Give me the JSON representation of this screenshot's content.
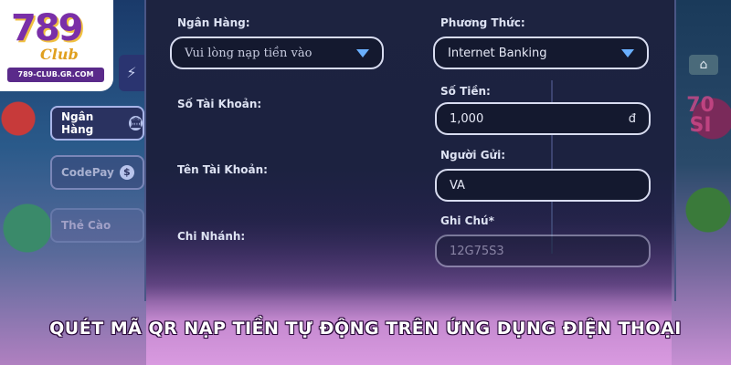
{
  "logo": {
    "number": "789",
    "club": "Club",
    "url": "789-CLUB.GR.COM"
  },
  "sidebar": {
    "top_icon": "⚡",
    "tabs": [
      {
        "label": "Ngân Hàng",
        "icon": "🏛"
      },
      {
        "label": "CodePay",
        "icon": "$"
      },
      {
        "label": "Thẻ Cào",
        "icon": ""
      }
    ]
  },
  "form": {
    "bank_label": "Ngân Hàng:",
    "bank_value": "Vui lòng nạp tiền vào",
    "method_label": "Phương Thức:",
    "method_value": "Internet Banking",
    "account_number_label": "Số Tài Khoản:",
    "amount_label": "Số Tiền:",
    "amount_value": "1,000",
    "amount_currency": "đ",
    "account_name_label": "Tên Tài Khoản:",
    "sender_label": "Người Gửi:",
    "sender_value": "VA",
    "branch_label": "Chi Nhánh:",
    "note_label": "Ghi Chú*",
    "note_value": "12G75S3"
  },
  "right_side": {
    "text": "70\nSI",
    "icon": "⌂"
  },
  "banner": {
    "text": "QUÉT MÃ QR NẠP TIỀN TỰ ĐỘNG TRÊN ỨNG DỤNG ĐIỆN THOẠI"
  },
  "colors": {
    "accent": "#6ab0ff",
    "panel": "#1d2340",
    "banner_glow": "#d99ae0"
  }
}
